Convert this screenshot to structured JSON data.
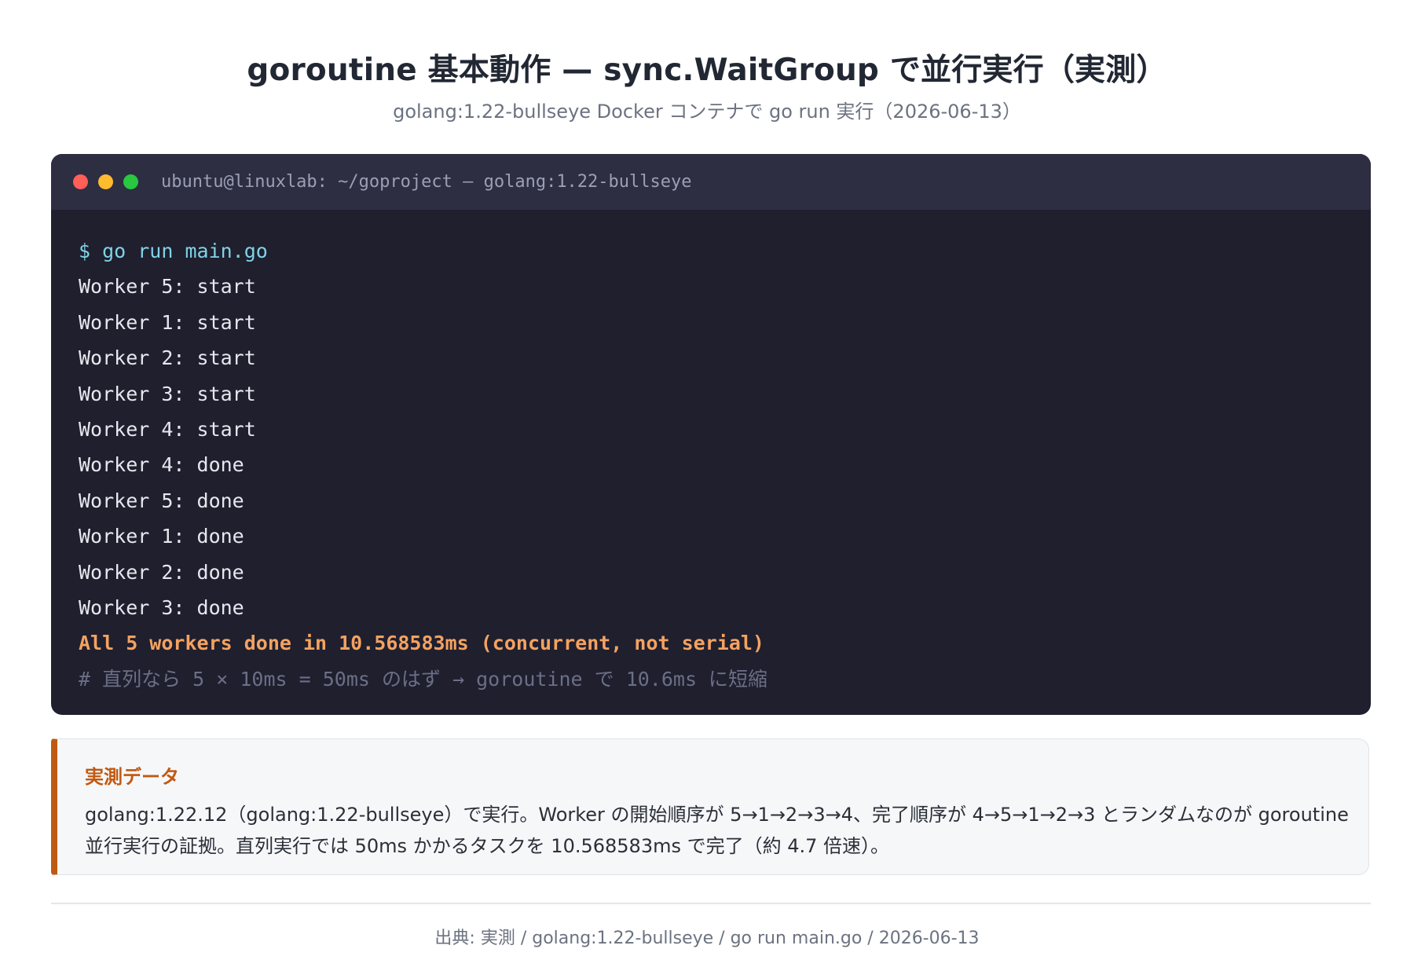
{
  "header": {
    "title": "goroutine 基本動作 — sync.WaitGroup で並行実行（実測）",
    "subtitle": "golang:1.22-bullseye Docker コンテナで go run 実行（2026-06-13）"
  },
  "terminal": {
    "window_title": "ubuntu@linuxlab: ~/goproject — golang:1.22-bullseye",
    "command": "$ go run main.go",
    "output_lines": [
      "Worker 5: start",
      "Worker 1: start",
      "Worker 2: start",
      "Worker 3: start",
      "Worker 4: start",
      "Worker 4: done",
      "Worker 5: done",
      "Worker 1: done",
      "Worker 2: done",
      "Worker 3: done"
    ],
    "summary": "All 5 workers done in 10.568583ms (concurrent, not serial)",
    "comment": "# 直列なら 5 × 10ms = 50ms のはず → goroutine で 10.6ms に短縮",
    "colors": {
      "background": "#1f1f2e",
      "titlebar": "#2d2e42",
      "command": "#7fd3e6",
      "summary": "#f4a261",
      "comment": "#6b6f86"
    }
  },
  "note": {
    "title": "実測データ",
    "text": "golang:1.22.12（golang:1.22-bullseye）で実行。Worker の開始順序が 5→1→2→3→4、完了順序が 4→5→1→2→3 とランダムなのが goroutine 並行実行の証拠。直列実行では 50ms かかるタスクを 10.568583ms で完了（約 4.7 倍速）。",
    "accent_color": "#c05a12"
  },
  "footer": {
    "source": "出典: 実測 / golang:1.22-bullseye / go run main.go / 2026-06-13"
  }
}
